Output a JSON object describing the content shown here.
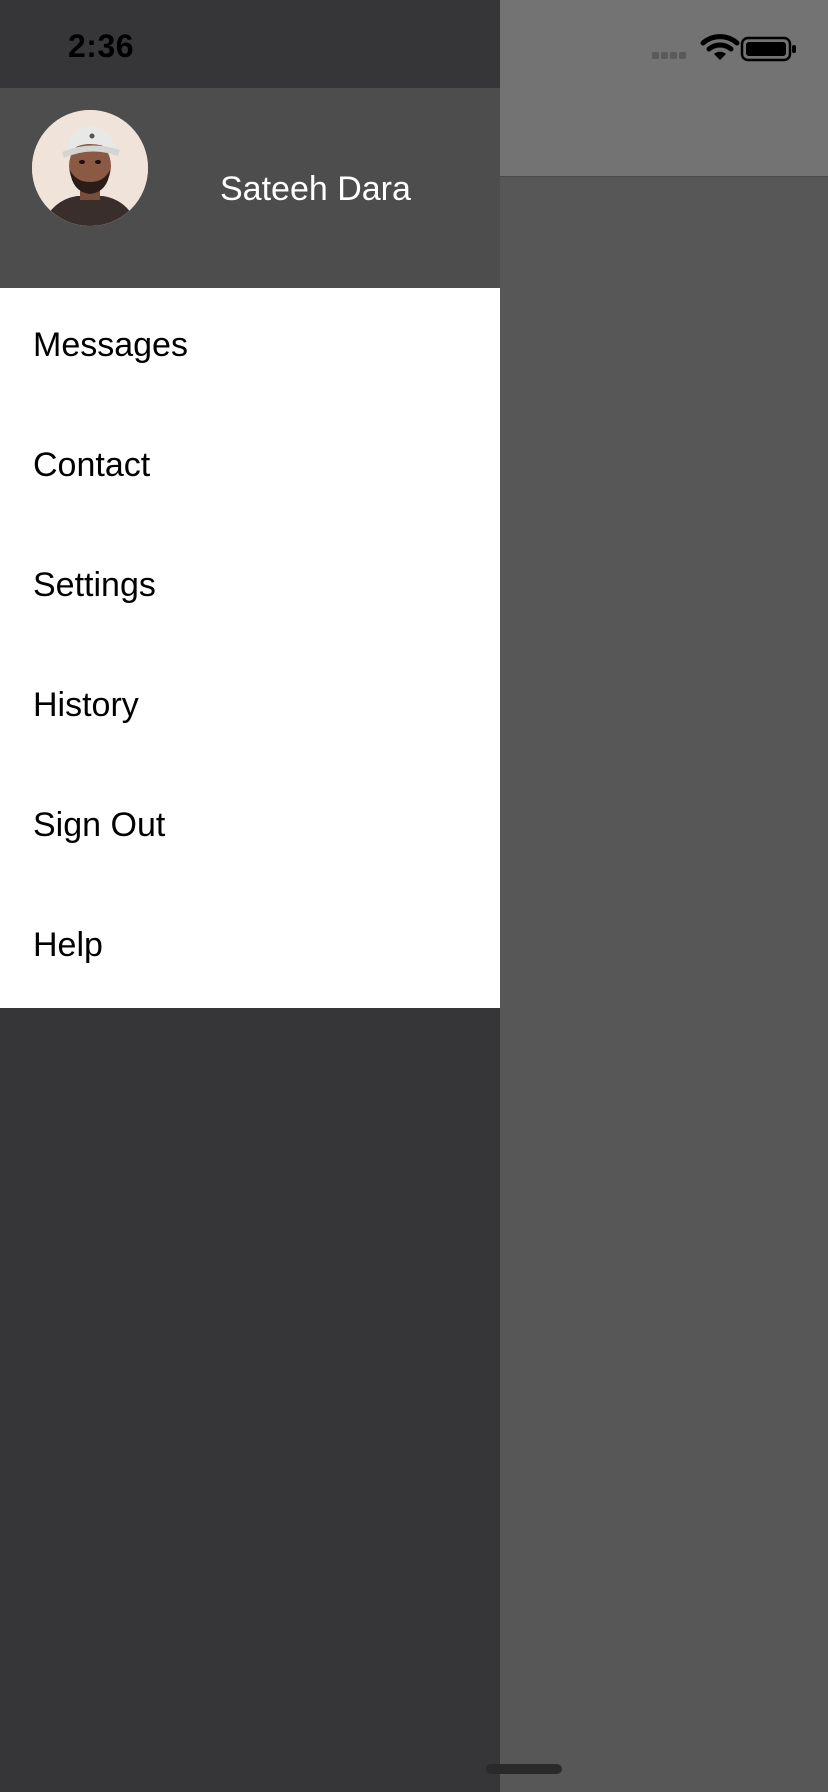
{
  "status_bar": {
    "time": "2:36",
    "signal_icon": "cellular-signal-icon",
    "wifi_icon": "wifi-icon",
    "battery_icon": "battery-icon"
  },
  "drawer": {
    "user": {
      "name": "Sateeh Dara",
      "avatar_icon": "user-avatar"
    },
    "menu_items": [
      {
        "label": "Messages"
      },
      {
        "label": "Contact"
      },
      {
        "label": "Settings"
      },
      {
        "label": "History"
      },
      {
        "label": "Sign Out"
      },
      {
        "label": "Help"
      }
    ]
  },
  "colors": {
    "drawer_background": "#363638",
    "header_background": "#4d4d4d",
    "menu_background": "#ffffff",
    "overlay_navbar": "#737373",
    "overlay_content": "#575757"
  }
}
